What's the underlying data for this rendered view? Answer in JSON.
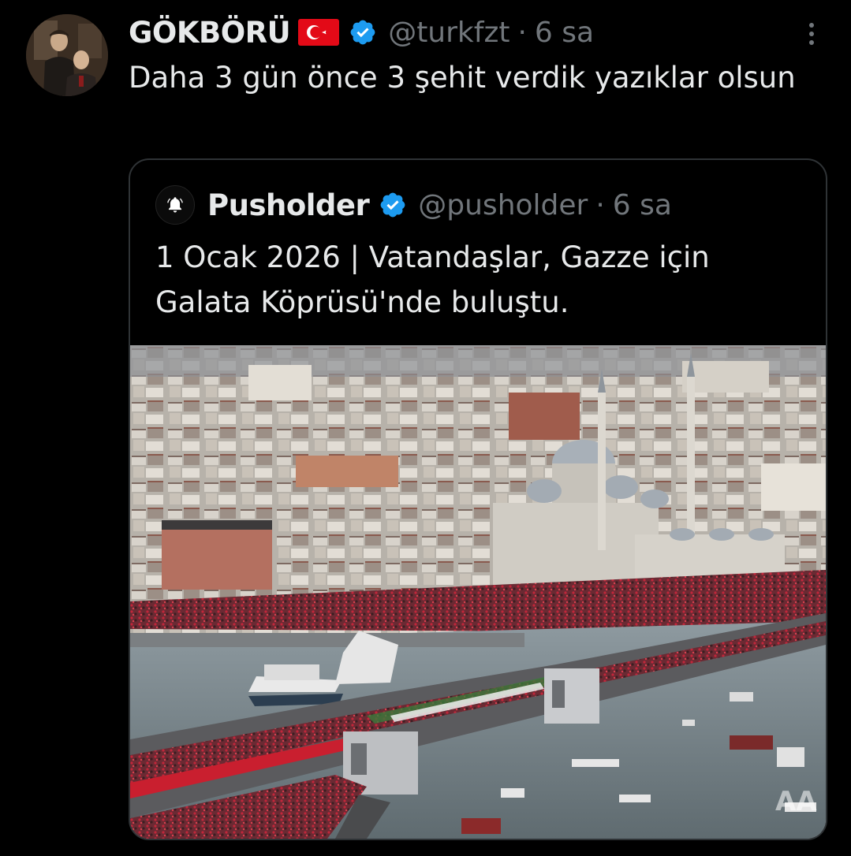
{
  "tweet": {
    "author_name": "GÖKBÖRÜ",
    "author_handle": "@turkfzt",
    "separator": "·",
    "time": "6 sa",
    "text": "Daha 3 gün önce 3 şehit verdik yazıklar olsun",
    "flag_icon": "turkey-flag-icon",
    "verified_icon": "verified-badge-icon"
  },
  "quote": {
    "author_name": "Pusholder",
    "author_handle": "@pusholder",
    "separator": "·",
    "time": "6 sa",
    "text": "1 Ocak 2026 | Vatandaşlar, Gazze için Galata Köprüsü'nde buluştu.",
    "avatar_icon": "bell-icon",
    "watermark": "AA"
  },
  "colors": {
    "background": "#000000",
    "text": "#e7e9ea",
    "secondary": "#71767b",
    "verified": "#1d9bf0",
    "border": "#2f3336",
    "flag_red": "#e30a17"
  }
}
